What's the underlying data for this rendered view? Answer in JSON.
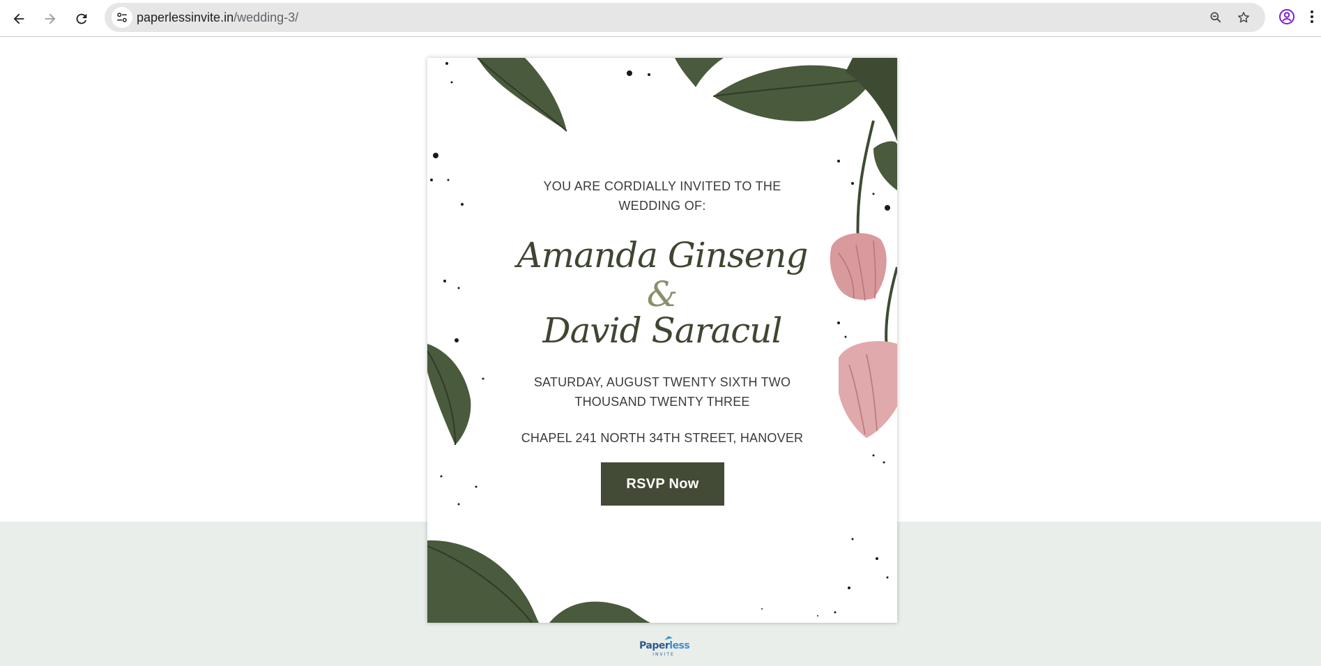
{
  "browser": {
    "url_domain": "paperlessinvite.in",
    "url_path": "/wedding-3/"
  },
  "invitation": {
    "lead_text": "YOU ARE CORDIALLY INVITED TO THE WEDDING OF:",
    "name_1": "Amanda Ginseng",
    "ampersand": "&",
    "name_2": "David Saracul",
    "date": "SATURDAY, AUGUST TWENTY SIXTH TWO THOUSAND TWENTY THREE",
    "venue": "CHAPEL 241 NORTH 34TH STREET, HANOVER",
    "rsvp_label": "RSVP Now"
  },
  "footer": {
    "brand_main": "Paper",
    "brand_accent": "less",
    "brand_sub": "INVITE"
  },
  "colors": {
    "leaf": "#4a5a3c",
    "leaf_dark": "#2f3b28",
    "flower": "#d89a9c",
    "button": "#434a35",
    "footer_band": "#e9eeeb",
    "name_text": "#3e4632"
  },
  "icons": {
    "back": "arrow-left",
    "forward": "arrow-right",
    "reload": "reload",
    "site_info": "tune",
    "zoom": "zoom-out",
    "bookmark": "star",
    "profile": "account-circle",
    "menu": "more-vertical"
  }
}
